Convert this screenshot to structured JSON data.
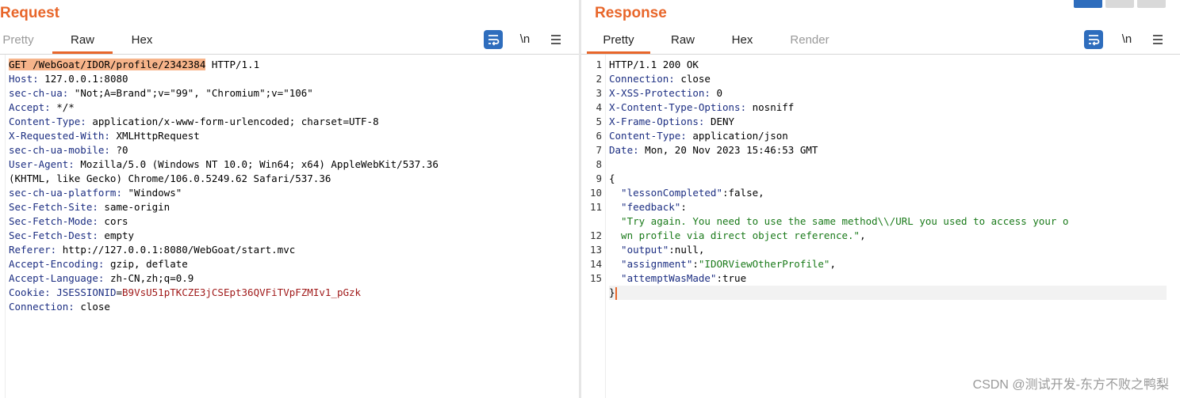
{
  "request": {
    "title": "Request",
    "tabs": [
      {
        "label": "Pretty",
        "active": false
      },
      {
        "label": "Raw",
        "active": true
      },
      {
        "label": "Hex",
        "active": false
      }
    ],
    "tools": {
      "wrap_icon": "word-wrap-icon",
      "newline_label": "\\n",
      "menu_icon": "hamburger-menu-icon"
    },
    "lines": {
      "request_line": "GET /WebGoat/IDOR/profile/2342384",
      "request_line_rest": " HTTP/1.1",
      "headers": [
        {
          "k": "Host:",
          "v": " 127.0.0.1:8080"
        },
        {
          "k": "sec-ch-ua:",
          "v": " \"Not;A=Brand\";v=\"99\", \"Chromium\";v=\"106\""
        },
        {
          "k": "Accept:",
          "v": " */*"
        },
        {
          "k": "Content-Type:",
          "v": " application/x-www-form-urlencoded; charset=UTF-8"
        },
        {
          "k": "X-Requested-With:",
          "v": " XMLHttpRequest"
        },
        {
          "k": "sec-ch-ua-mobile:",
          "v": " ?0"
        },
        {
          "k": "User-Agent:",
          "v": " Mozilla/5.0 (Windows NT 10.0; Win64; x64) AppleWebKit/537.36"
        },
        {
          "k": "",
          "v": "(KHTML, like Gecko) Chrome/106.0.5249.62 Safari/537.36"
        },
        {
          "k": "sec-ch-ua-platform:",
          "v": " \"Windows\""
        },
        {
          "k": "Sec-Fetch-Site:",
          "v": " same-origin"
        },
        {
          "k": "Sec-Fetch-Mode:",
          "v": " cors"
        },
        {
          "k": "Sec-Fetch-Dest:",
          "v": " empty"
        },
        {
          "k": "Referer:",
          "v": " http://127.0.0.1:8080/WebGoat/start.mvc"
        },
        {
          "k": "Accept-Encoding:",
          "v": " gzip, deflate"
        },
        {
          "k": "Accept-Language:",
          "v": " zh-CN,zh;q=0.9"
        }
      ],
      "cookie_key": "Cookie:",
      "cookie_name": "JSESSIONID",
      "cookie_eq": "=",
      "cookie_value": "B9VsU51pTKCZE3jCSEpt36QVFiTVpFZMIv1_pGzk",
      "connection": {
        "k": "Connection:",
        "v": " close"
      }
    }
  },
  "response": {
    "title": "Response",
    "tabs": [
      {
        "label": "Pretty",
        "active": true
      },
      {
        "label": "Raw",
        "active": false
      },
      {
        "label": "Hex",
        "active": false
      },
      {
        "label": "Render",
        "active": false
      }
    ],
    "tools": {
      "wrap_icon": "word-wrap-icon",
      "newline_label": "\\n",
      "menu_icon": "hamburger-menu-icon"
    },
    "line_numbers": [
      "1",
      "2",
      "3",
      "4",
      "5",
      "6",
      "7",
      "8",
      "9",
      "10",
      "11",
      "",
      "12",
      "13",
      "14",
      "15"
    ],
    "lines": {
      "status": "HTTP/1.1 200 OK",
      "headers": [
        {
          "k": "Connection:",
          "v": " close"
        },
        {
          "k": "X-XSS-Protection:",
          "v": " 0"
        },
        {
          "k": "X-Content-Type-Options:",
          "v": " nosniff"
        },
        {
          "k": "X-Frame-Options:",
          "v": " DENY"
        },
        {
          "k": "Content-Type:",
          "v": " application/json"
        },
        {
          "k": "Date:",
          "v": " Mon, 20 Nov 2023 15:46:53 GMT"
        }
      ],
      "open_brace": "{",
      "lessonCompleted_key": "  \"lessonCompleted\"",
      "lessonCompleted_val": ":false,",
      "feedback_key": "  \"feedback\"",
      "feedback_colon": ":",
      "feedback_val_1": "  \"Try again. You need to use the same method\\\\/URL you used to access your o",
      "feedback_val_2": "  wn profile via direct object reference.\"",
      "feedback_comma": ",",
      "output_key": "  \"output\"",
      "output_val": ":null,",
      "assignment_key": "  \"assignment\"",
      "assignment_colon": ":",
      "assignment_val": "\"IDORViewOtherProfile\"",
      "assignment_comma": ",",
      "attempt_key": "  \"attemptWasMade\"",
      "attempt_val": ":true",
      "close_brace": "}"
    }
  },
  "view_toggle": {
    "icons": [
      "split-horizontal-icon",
      "split-vertical-icon",
      "single-pane-icon"
    ],
    "active_index": 0,
    "accent": "#2e6dbd"
  },
  "watermark": "CSDN @测试开发-东方不败之鸭梨",
  "colors": {
    "accent": "#e8662a",
    "header_key": "#1c2e82",
    "cookie_value": "#a01a1a",
    "json_string": "#1a7a1a",
    "button_blue": "#2e6dbd"
  }
}
